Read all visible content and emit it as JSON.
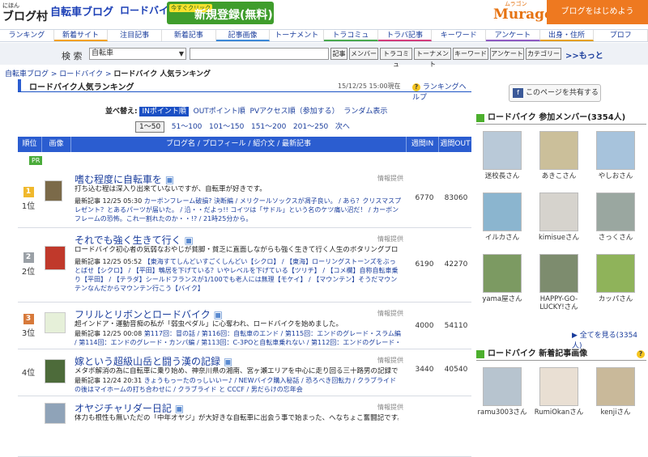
{
  "header": {
    "site_small": "にほん",
    "site_logo": "ブログ村",
    "category1": "自転車ブログ",
    "category2": "ロードバイク",
    "reg_small": "今すぐクリック",
    "reg_big": "新規登録(無料)",
    "muragon_kana": "ムラゴン",
    "muragon_name": "Muragon",
    "start_blog": "ブログをはじめよう"
  },
  "nav": [
    "ランキング",
    "新着サイト",
    "注目記事",
    "新着記事",
    "記事画像",
    "トーナメント",
    "トラコミュ",
    "トラバ記事",
    "キーワード",
    "アンケート",
    "出身・住所",
    "プロフ"
  ],
  "search": {
    "label": "検 索",
    "select_value": "自転車",
    "buttons": [
      "記事",
      "メンバー",
      "トラコミュ",
      "トーナメント",
      "キーワード",
      "アンケート",
      "カテゴリー"
    ],
    "more": ">>もっと"
  },
  "breadcrumb": {
    "a": "自転車ブログ",
    "b": "ロードバイク",
    "c": "ロードバイク 人気ランキング"
  },
  "ranking": {
    "title": "ロードバイク人気ランキング",
    "date": "15/12/25 15:00現在",
    "help": "ランキングヘルプ",
    "sort_label": "並べ替え:",
    "sorts": [
      "INポイント順",
      "OUTポイント順",
      "PVアクセス順（参加する）",
      "ランダム表示"
    ],
    "pages": [
      "1～50",
      "51～100",
      "101～150",
      "151～200",
      "201～250",
      "次へ"
    ],
    "columns": [
      "順位",
      "画像",
      "ブログ名 / プロフィール / 紹介文 / 最新記事",
      "週間IN",
      "週間OUT"
    ],
    "pr": "PR",
    "ad": "情報提供",
    "rows": [
      {
        "rank": "1位",
        "medal": "1",
        "title": "嗜む程度に自転車を",
        "desc": "打ち込む程は深入り出来ていないですが、自転車が好きです。",
        "latest_label": "最新記事",
        "time": "12/25 05:30",
        "links": "カーボンフレーム破損? 決断編 / メリクールソックスが凋子良い。 / あら？クリスマスプレゼント？とあるパーツが届いた。 / 沿・・だよっ!! コイツは「サドル」という名のケツ痛い沼だ！ / カーボンフレームの恐怖。これ一割れたのか・・!? / 21時25分から。",
        "in": "6770",
        "out": "83060"
      },
      {
        "rank": "2位",
        "medal": "2",
        "title": "それでも強く生きて行く",
        "desc": "ロードバイク初心者の気弱なおやじが貧脚・貧乏に直面しながらも強く生きて行く人生のポタリングブログ",
        "latest_label": "最新記事",
        "time": "12/25 05:52",
        "links": "【東海すてしんどいすごくしんどい【シクロ】 / 【東海】ローリングストーンズをぶっとばせ【シクロ】 / 【平田】鵯居を下げている？いやレベルを下げている【ツリチ】 / 【コメ欄】自称自転車乗り【平田】 / 【テラダ】シールドフランスが1/100でも老人には無理【モケイ】 / 【マウンテン】そうだマウンテンなんだからマウンテン行こう【バイク】",
        "in": "6190",
        "out": "42270"
      },
      {
        "rank": "3位",
        "medal": "3",
        "title": "フリルとリボンとロードバイク",
        "desc": "超インドア・運動音痴の私が「弱虫ペダル」に心奪われ、ロードバイクを始めました。",
        "latest_label": "最新記事",
        "time": "12/25 00:08",
        "links": "第117回：冒の話 / 第116回：自転車のエンド / 第115回：エンドのグレード・スラム編 / 第114回：エンドのグレード・カンパ編 / 第113回：C-3POと自転車乗れない / 第112回：エンドのグレード・シマノ編",
        "in": "4000",
        "out": "54110"
      },
      {
        "rank": "4位",
        "medal": "",
        "title": "嫁という超級山岳と闘う漢の記録",
        "desc": "メタボ解消の為に自転車に乗り始め、神奈川県の湘南、宮ヶ瀬エリアを中心に走り回る三十路男の記録です。",
        "latest_label": "最新記事",
        "time": "12/24 20:31",
        "links": "きょうもっーたのっしいいー♪ / NEWバイク購入秘話 / 恐ろべき回転力 / クラブライドの後はマイホームの打ち合わせに / クラブライド と CCCF / 男だらけの忘年会",
        "in": "3440",
        "out": "40540"
      },
      {
        "rank": "",
        "medal": "",
        "title": "オヤジチャリダー日記",
        "desc": "体力も根性も無いただの「中年オヤジ」が大好きな自転車に出会う事で始まった、へなちょこ奮闘記です。",
        "latest_label": "",
        "time": "",
        "links": "",
        "in": "",
        "out": ""
      }
    ]
  },
  "side": {
    "share": "このページを共有する",
    "share_icon_text": "f",
    "members_title": "ロードバイク 参加メンバー(3354人)",
    "members": [
      "迷校長さん",
      "あきこさん",
      "やしおさん",
      "イルカさん",
      "kimisueさん",
      "さっくさん",
      "yama屋さん",
      "HAPPY-GO-LUCKY!さん",
      "カッパさん"
    ],
    "all_members": "全てを見る(3354人)",
    "photos_title": "ロードバイク 新着記事画像",
    "photos": [
      "ramu3003さん",
      "RumiOkanさん",
      "kenjiさん"
    ]
  },
  "colors": {
    "accent": "#2b5dd0",
    "green": "#4caf2d",
    "orange": "#ee7920"
  }
}
